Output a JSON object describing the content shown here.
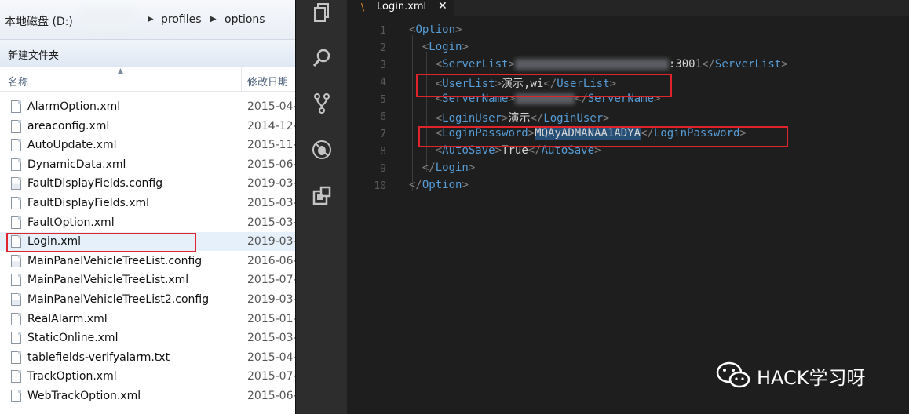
{
  "explorer": {
    "breadcrumb": {
      "drive": "本地磁盘 (D:)",
      "folder1": "profiles",
      "folder2": "options"
    },
    "toolbar": {
      "new_folder": "新建文件夹"
    },
    "columns": {
      "name": "名称",
      "date": "修改日期"
    },
    "files": [
      {
        "name": "AlarmOption.xml",
        "date": "2015-04-",
        "icon": "xml-file-icon"
      },
      {
        "name": "areaconfig.xml",
        "date": "2014-12-",
        "icon": "xml-file-icon"
      },
      {
        "name": "AutoUpdate.xml",
        "date": "2015-11-",
        "icon": "xml-file-icon"
      },
      {
        "name": "DynamicData.xml",
        "date": "2015-06-",
        "icon": "xml-file-icon"
      },
      {
        "name": "FaultDisplayFields.config",
        "date": "2019-03-",
        "icon": "config-file-icon"
      },
      {
        "name": "FaultDisplayFields.xml",
        "date": "2015-03-",
        "icon": "xml-file-icon"
      },
      {
        "name": "FaultOption.xml",
        "date": "2015-03-",
        "icon": "xml-file-icon"
      },
      {
        "name": "Login.xml",
        "date": "2019-03-",
        "icon": "xml-file-icon"
      },
      {
        "name": "MainPanelVehicleTreeList.config",
        "date": "2016-06-",
        "icon": "config-file-icon"
      },
      {
        "name": "MainPanelVehicleTreeList.xml",
        "date": "2015-07-",
        "icon": "xml-file-icon"
      },
      {
        "name": "MainPanelVehicleTreeList2.config",
        "date": "2019-03-",
        "icon": "config-file-icon"
      },
      {
        "name": "RealAlarm.xml",
        "date": "2015-01-",
        "icon": "xml-file-icon"
      },
      {
        "name": "StaticOnline.xml",
        "date": "2015-03-",
        "icon": "xml-file-icon"
      },
      {
        "name": "tablefields-verifyalarm.txt",
        "date": "2015-04-",
        "icon": "txt-file-icon"
      },
      {
        "name": "TrackOption.xml",
        "date": "2015-07-",
        "icon": "xml-file-icon"
      },
      {
        "name": "WebTrackOption.xml",
        "date": "2015-06-",
        "icon": "xml-file-icon"
      }
    ]
  },
  "editor": {
    "tab": {
      "title": "Login.xml",
      "close": "✕"
    },
    "lines": [
      {
        "n": "1",
        "open": "Option"
      },
      {
        "n": "2",
        "open": "Login"
      },
      {
        "n": "3",
        "open": "ServerList",
        "value": ":3001",
        "close": "ServerList"
      },
      {
        "n": "4",
        "open": "UserList",
        "value": "演示,wi",
        "close": "UserList"
      },
      {
        "n": "5",
        "open": "ServerName",
        "value": "",
        "close": "ServerName"
      },
      {
        "n": "6",
        "open": "LoginUser",
        "value": "演示",
        "close": "LoginUser"
      },
      {
        "n": "7",
        "open": "LoginPassword",
        "value": "MQAyADMANAA1ADYA",
        "close": "LoginPassword"
      },
      {
        "n": "8",
        "open": "AutoSave",
        "value": "True",
        "close": "AutoSave"
      },
      {
        "n": "9",
        "close": "Login"
      },
      {
        "n": "10",
        "close": "Option"
      }
    ]
  },
  "watermark": {
    "text": "HACK学习呀"
  },
  "colors": {
    "tag": "#569cd6",
    "bracket": "#808080",
    "highlight_box": "#e0242c",
    "selection": "#264f78"
  }
}
